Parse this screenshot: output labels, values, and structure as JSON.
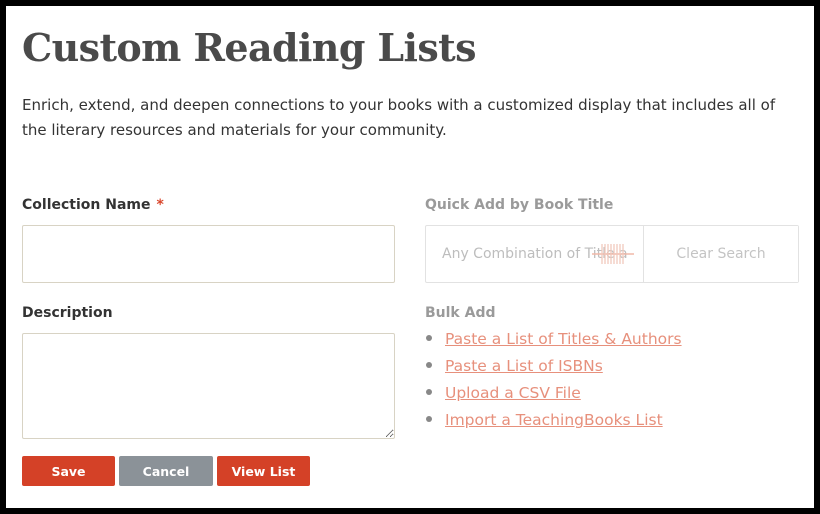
{
  "page": {
    "title": "Custom Reading Lists",
    "intro": "Enrich, extend, and deepen connections to your books with a customized display that includes all of the literary resources and materials for your community."
  },
  "form": {
    "collection_name": {
      "label": "Collection Name",
      "required_marker": "*",
      "value": ""
    },
    "description": {
      "label": "Description",
      "value": ""
    },
    "quick_add": {
      "label": "Quick Add by Book Title",
      "placeholder": "Any Combination of Title and Author",
      "value": "",
      "scan_icon": "barcode-icon",
      "clear_label": "Clear Search"
    },
    "bulk_add": {
      "label": "Bulk Add",
      "links": [
        {
          "label": "Paste a List of Titles & Authors"
        },
        {
          "label": "Paste a List of ISBNs"
        },
        {
          "label": "Upload a CSV File"
        },
        {
          "label": "Import a TeachingBooks List"
        }
      ]
    },
    "buttons": {
      "save": "Save",
      "cancel": "Cancel",
      "view_list": "View List"
    }
  },
  "colors": {
    "primary": "#d44127",
    "secondary": "#8b9298",
    "link": "#e7907c",
    "required": "#d9452b",
    "heading": "#4a4a4a"
  }
}
